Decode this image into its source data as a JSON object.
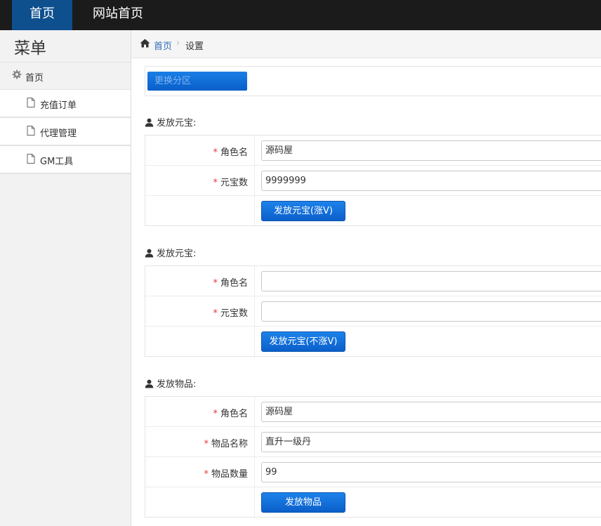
{
  "topnav": {
    "home_label": "首页",
    "site_home_label": "网站首页"
  },
  "sidebar": {
    "title": "菜单",
    "home_label": "首页",
    "items": [
      {
        "label": "充值订单"
      },
      {
        "label": "代理管理"
      },
      {
        "label": "GM工具"
      }
    ]
  },
  "breadcrumb": {
    "home": "首页",
    "current": "设置"
  },
  "region_button_label": "更换分区",
  "sections": [
    {
      "title": "发放元宝:",
      "fields": [
        {
          "label": "角色名",
          "value": "源码屋"
        },
        {
          "label": "元宝数",
          "value": "9999999"
        }
      ],
      "button_label": "发放元宝(涨V)"
    },
    {
      "title": "发放元宝:",
      "fields": [
        {
          "label": "角色名",
          "value": ""
        },
        {
          "label": "元宝数",
          "value": ""
        }
      ],
      "button_label": "发放元宝(不涨V)"
    },
    {
      "title": "发放物品:",
      "fields": [
        {
          "label": "角色名",
          "value": "源码屋"
        },
        {
          "label": "物品名称",
          "value": "直升一级丹"
        },
        {
          "label": "物品数量",
          "value": "99"
        }
      ],
      "button_label": "发放物品"
    }
  ],
  "colors": {
    "topbar": "#1b1b1b",
    "active_nav": "#0e4f8e",
    "button": "#0b5fca",
    "required_star": "#e4393c",
    "link": "#2a6fb8"
  },
  "icons": {
    "sidebar_home": "gear-icon",
    "sidebar_item": "document-icon",
    "breadcrumb_home": "home-icon",
    "section": "user-icon"
  }
}
